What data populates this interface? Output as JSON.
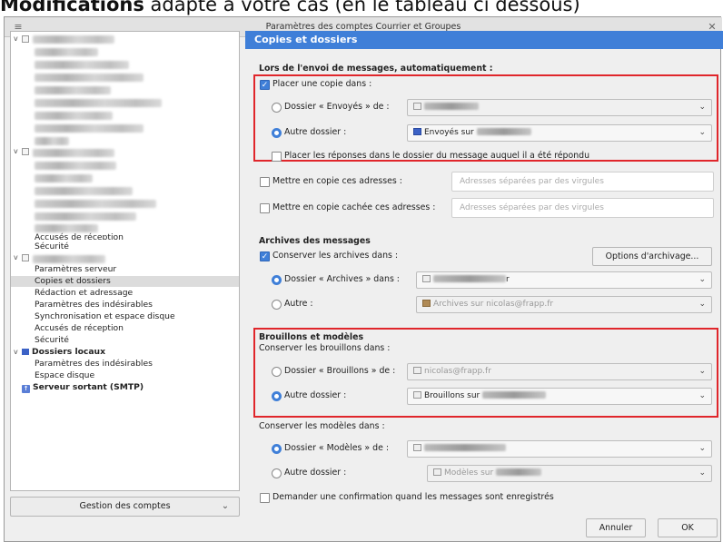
{
  "caption": {
    "bold": "Modifications",
    "rest": " adapte à votre cas (en le tableau ci dessous)"
  },
  "window": {
    "title": "Paramètres des comptes Courrier et Groupes",
    "menu_icon": "hamburger-icon",
    "close_icon": "close-icon"
  },
  "sidebar": {
    "items": [
      {
        "label": "Accusés de réception"
      },
      {
        "label": "Sécurité"
      },
      {
        "label": "Paramètres serveur"
      },
      {
        "label": "Copies et dossiers",
        "selected": true
      },
      {
        "label": "Rédaction et adressage"
      },
      {
        "label": "Paramètres des indésirables"
      },
      {
        "label": "Synchronisation et espace disque"
      },
      {
        "label": "Accusés de réception"
      },
      {
        "label": "Sécurité"
      },
      {
        "label": "Dossiers locaux"
      },
      {
        "label": "Paramètres des indésirables"
      },
      {
        "label": "Espace disque"
      },
      {
        "label": "Serveur sortant (SMTP)"
      }
    ],
    "account_actions": "Gestion des comptes"
  },
  "panel": {
    "title": "Copies et dossiers",
    "sending_section": "Lors de l'envoi de messages, automatiquement :",
    "place_copy": "Placer une copie dans :",
    "sent_folder_of": "Dossier « Envoyés » de :",
    "other_folder": "Autre dossier :",
    "other_folder_value": "Envoyés sur",
    "place_replies": "Placer les réponses dans le dossier du message auquel il a été répondu",
    "cc_label": "Mettre en copie ces adresses :",
    "cc_placeholder": "Adresses séparées par des virgules",
    "bcc_label": "Mettre en copie cachée ces adresses :",
    "bcc_placeholder": "Adresses séparées par des virgules",
    "archives_section": "Archives des messages",
    "keep_archives": "Conserver les archives dans :",
    "archive_options": "Options d'archivage...",
    "archives_folder_of": "Dossier « Archives » dans :",
    "archives_folder_value_suffix": "r",
    "other": "Autre :",
    "other_archives_value": "Archives sur nicolas@frapp.fr",
    "drafts_section": "Brouillons et modèles",
    "keep_drafts": "Conserver les brouillons dans :",
    "drafts_folder_of": "Dossier « Brouillons » de :",
    "drafts_folder_value": "nicolas@frapp.fr",
    "other_drafts_folder": "Autre dossier :",
    "other_drafts_value": "Brouillons sur",
    "keep_templates": "Conserver les modèles dans :",
    "templates_folder_of": "Dossier « Modèles » de :",
    "other_templates_folder": "Autre dossier :",
    "other_templates_value": "Modèles sur",
    "confirm_save": "Demander une confirmation quand les messages sont enregistrés",
    "cancel": "Annuler",
    "ok": "OK"
  },
  "colors": {
    "accent": "#3f7fd8",
    "highlight_box": "#e0262b"
  }
}
